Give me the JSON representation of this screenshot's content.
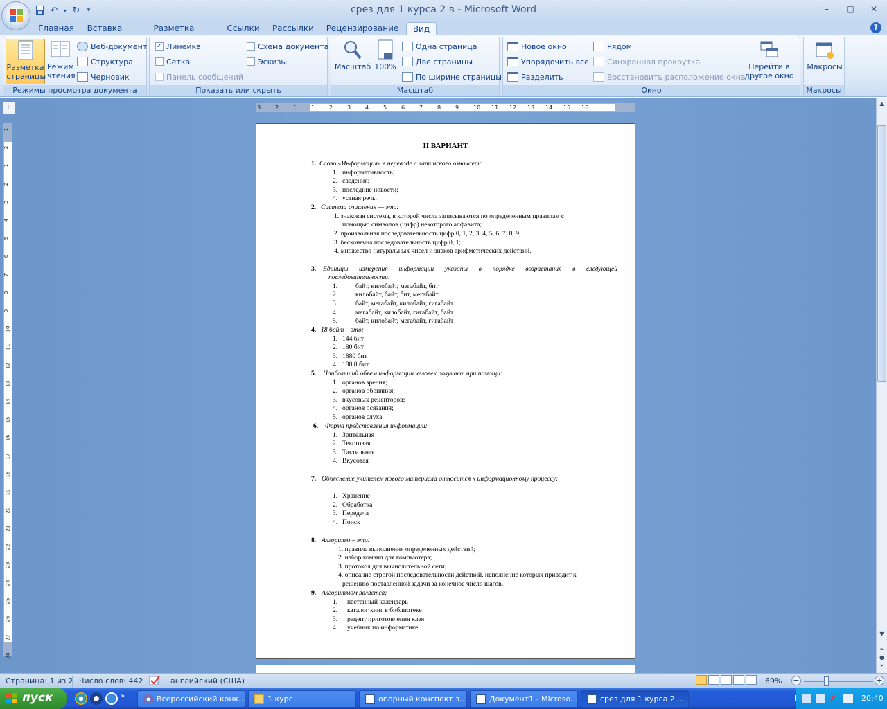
{
  "window": {
    "title": "срез для 1 курса  2 в  -  Microsoft Word",
    "minimize": "–",
    "maximize": "□",
    "close": "✕"
  },
  "qat": {
    "save_icon": "save-icon",
    "undo_icon": "undo-icon",
    "redo_icon": "redo-icon",
    "customize": "▾"
  },
  "tabs": [
    "Главная",
    "Вставка",
    "Разметка страницы",
    "Ссылки",
    "Рассылки",
    "Рецензирование",
    "Вид"
  ],
  "active_tab": "Вид",
  "help": "?",
  "ribbon": {
    "views": {
      "caption": "Режимы просмотра документа",
      "print_layout": "Разметка страницы",
      "reading": "Режим чтения",
      "web": "Веб-документ",
      "outline": "Структура",
      "draft": "Черновик"
    },
    "show_hide": {
      "caption": "Показать или скрыть",
      "ruler": "Линейка",
      "gridlines": "Сетка",
      "message_bar": "Панель сообщений",
      "doc_map": "Схема документа",
      "thumbnails": "Эскизы"
    },
    "zoom": {
      "caption": "Масштаб",
      "zoom": "Масштаб",
      "hundred": "100%",
      "one_page": "Одна страница",
      "two_pages": "Две страницы",
      "page_width": "По ширине страницы"
    },
    "window": {
      "caption": "Окно",
      "new_window": "Новое окно",
      "arrange_all": "Упорядочить все",
      "split": "Разделить",
      "side_by_side": "Рядом",
      "sync_scroll": "Синхронная прокрутка",
      "reset_position": "Восстановить расположение окна",
      "switch_windows": "Перейти в другое окно"
    },
    "macros": {
      "caption": "Макросы",
      "macros": "Макросы"
    }
  },
  "document": {
    "title": "II ВАРИАНТ",
    "lines": [
      "1.",
      "Слово «Информация» в переводе с латинского означает:",
      "1.",
      "информативность;",
      "2.",
      "сведения;",
      "3.",
      "последние новости;",
      "4.",
      "устная речь.",
      "2.",
      "Система счисления — это:",
      "1. знаковая система, в которой числа записываются по определенным правилам с",
      "помощью символов (цифр) некоторого алфавита;",
      "2. произвольная последовательность цифр 0, 1, 2, 3, 4, 5, 6, 7, 8, 9;",
      "3. бесконечна последовательность цифр 0, 1;",
      "4. множество натуральных чисел и знаков арифметических действий.",
      "3.",
      "Единицы измерения информации указаны в порядке возрастания в следующей",
      "последовательности:",
      "1.",
      "байт, килобайт, мегабайт, бит",
      "2.",
      "килобайт, байт, бит, мегабайт",
      "3.",
      "байт, мегабайт, килобайт, гигабайт",
      "4.",
      "мегабайт, килобайт, гигабайт, байт",
      "5.",
      "байт, килобайт, мегабайт, гигабайт",
      "4.",
      "18 байт – это:",
      "1.",
      "144 бит",
      "2.",
      "180 бит",
      "3.",
      "1880 бит",
      "4.",
      "188,8 бит",
      "5.",
      "Наибольший объем информации человек получает при помощи:",
      "1.",
      "органов зрения;",
      "2.",
      "органов обоняния;",
      "3.",
      "вкусовых рецепторов;",
      "4.",
      "органов осязания;",
      "5.",
      "органов слуха",
      "6.",
      "Форма представления информации:",
      "1.",
      "Зрительная",
      "2.",
      "Текстовая",
      "3.",
      "Тактильная",
      "4.",
      "Вкусовая",
      "7.",
      "Объяснение учителем нового материала относится к информационному процессу:",
      "1.",
      "Хранение",
      "2.",
      "Обработка",
      "3.",
      "Передача",
      "4.",
      "Поиск",
      "8.",
      "Алгоритм – это:",
      "1. правила выполнения определенных действий;",
      "2. набор команд для компьютера;",
      "3. протокол для вычислительной сети;",
      "4. описание строгой последовательности действий, исполнение которых приводит к",
      "решению поставленной задачи за конечное число шагов.",
      "9.",
      "Алгоритмом является:",
      "1.",
      "настенный календарь",
      "2.",
      "каталог книг в библиотеке",
      "3.",
      "рецепт приготовления клея",
      "4.",
      "учебник по информатике"
    ]
  },
  "ruler": {
    "h_ticks": [
      "3",
      "2",
      "1",
      "1",
      "2",
      "3",
      "4",
      "5",
      "6",
      "7",
      "8",
      "9",
      "10",
      "11",
      "12",
      "13",
      "14",
      "15",
      "16"
    ],
    "v_ticks": [
      "1",
      "2",
      "1",
      "2",
      "3",
      "4",
      "5",
      "6",
      "7",
      "8",
      "9",
      "10",
      "11",
      "12",
      "13",
      "14",
      "15",
      "16",
      "17",
      "18",
      "19",
      "20",
      "21",
      "22",
      "23",
      "24",
      "25",
      "26",
      "27",
      "28"
    ],
    "corner": "L"
  },
  "status": {
    "page": "Страница: 1 из 2",
    "words": "Число слов: 442",
    "language": "английский (США)",
    "zoom": "69%",
    "zoom_level": 0.69,
    "minus": "−",
    "plus": "+"
  },
  "taskbar": {
    "start": "пуск",
    "tasks": [
      "Всероссийский конк...",
      "1 курс",
      "опорный конспект з...",
      "Документ1 - Microso...",
      "срез для 1 курса  2 ..."
    ],
    "lang": "RU",
    "clock": "20:40"
  }
}
